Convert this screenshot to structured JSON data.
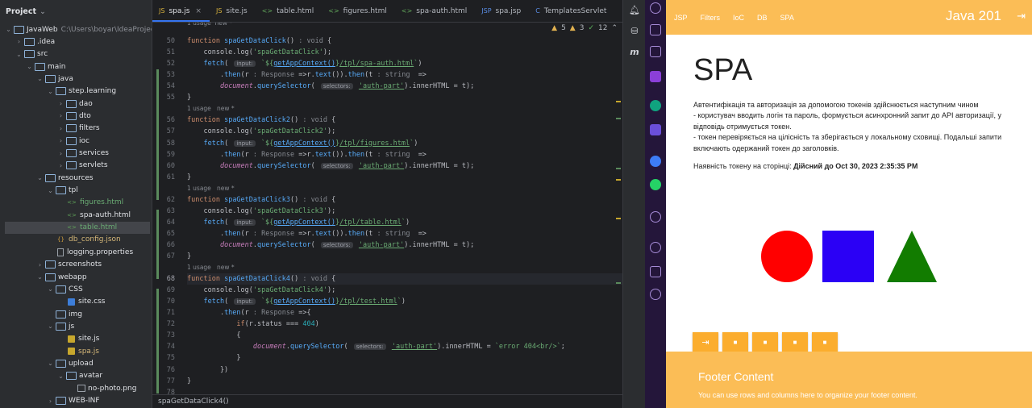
{
  "project": {
    "title": "Project",
    "rows": [
      {
        "label": "JavaWeb",
        "path": "C:\\Users\\boyar\\IdeaProject\\",
        "icon": "folder",
        "arrow": "v",
        "d": 0
      },
      {
        "label": ".idea",
        "icon": "folder",
        "arrow": ">",
        "d": 1
      },
      {
        "label": "src",
        "icon": "folder",
        "arrow": "v",
        "d": 1
      },
      {
        "label": "main",
        "icon": "folder",
        "arrow": "v",
        "d": 2
      },
      {
        "label": "java",
        "icon": "folder",
        "arrow": "v",
        "d": 3
      },
      {
        "label": "step.learning",
        "icon": "folder",
        "arrow": "v",
        "d": 4
      },
      {
        "label": "dao",
        "icon": "folder",
        "arrow": ">",
        "d": 5
      },
      {
        "label": "dto",
        "icon": "folder",
        "arrow": ">",
        "d": 5
      },
      {
        "label": "filters",
        "icon": "folder",
        "arrow": ">",
        "d": 5
      },
      {
        "label": "ioc",
        "icon": "folder",
        "arrow": ">",
        "d": 5
      },
      {
        "label": "services",
        "icon": "folder",
        "arrow": ">",
        "d": 5
      },
      {
        "label": "servlets",
        "icon": "folder",
        "arrow": ">",
        "d": 5
      },
      {
        "label": "resources",
        "icon": "folder",
        "arrow": "v",
        "d": 3
      },
      {
        "label": "tpl",
        "icon": "folder",
        "arrow": "v",
        "d": 4
      },
      {
        "label": "figures.html",
        "icon": "html",
        "arrow": "",
        "d": 5,
        "c": "g"
      },
      {
        "label": "spa-auth.html",
        "icon": "html",
        "arrow": "",
        "d": 5
      },
      {
        "label": "table.html",
        "icon": "html",
        "arrow": "",
        "d": 5,
        "c": "g",
        "sel": true
      },
      {
        "label": "db_config.json",
        "icon": "json",
        "arrow": "",
        "d": 4,
        "c": "y"
      },
      {
        "label": "logging.properties",
        "icon": "file",
        "arrow": "",
        "d": 4
      },
      {
        "label": "screenshots",
        "icon": "folder",
        "arrow": ">",
        "d": 3
      },
      {
        "label": "webapp",
        "icon": "folder",
        "arrow": "v",
        "d": 3
      },
      {
        "label": "CSS",
        "icon": "folder",
        "arrow": "v",
        "d": 4
      },
      {
        "label": "site.css",
        "icon": "css",
        "arrow": "",
        "d": 5
      },
      {
        "label": "img",
        "icon": "folder",
        "arrow": "",
        "d": 4
      },
      {
        "label": "js",
        "icon": "folder",
        "arrow": "v",
        "d": 4
      },
      {
        "label": "site.js",
        "icon": "js",
        "arrow": "",
        "d": 5
      },
      {
        "label": "spa.js",
        "icon": "js",
        "arrow": "",
        "d": 5,
        "c": "y"
      },
      {
        "label": "upload",
        "icon": "folder",
        "arrow": "v",
        "d": 4
      },
      {
        "label": "avatar",
        "icon": "folder",
        "arrow": "v",
        "d": 5
      },
      {
        "label": "no-photo.png",
        "icon": "img",
        "arrow": "",
        "d": 6
      },
      {
        "label": "WEB-INF",
        "icon": "folder",
        "arrow": ">",
        "d": 4
      }
    ]
  },
  "tabs": [
    {
      "label": "spa.js",
      "icon": "JS",
      "active": true
    },
    {
      "label": "site.js",
      "icon": "JS"
    },
    {
      "label": "table.html",
      "icon": "<>"
    },
    {
      "label": "figures.html",
      "icon": "<>"
    },
    {
      "label": "spa-auth.html",
      "icon": "<>"
    },
    {
      "label": "spa.jsp",
      "icon": "JSP"
    },
    {
      "label": "TemplatesServlet",
      "icon": "C"
    }
  ],
  "inspections": {
    "warnings": "5",
    "weak": "3",
    "checks": "12"
  },
  "lines": {
    "first": 50,
    "last": 78,
    "current": 68
  },
  "hints": {
    "usage": "1 usage",
    "new": "new *",
    "topFragment": "1 usage  new *"
  },
  "code": {
    "f1": "spaGetDataClick",
    "f2": "spaGetDataClick2",
    "f3": "spaGetDataClick3",
    "f4": "spaGetDataClick4",
    "l1": "'spaGetDataClick'",
    "l2": "'spaGetDataClick2'",
    "l3": "'spaGetDataClick3'",
    "l4": "'spaGetDataClick4'",
    "u1": "/tpl/spa-auth.html",
    "u2": "/tpl/figures.html",
    "u3": "/tpl/table.html",
    "u4": "/tpl/test.html",
    "ctx": "getAppContext()",
    "sel": "'auth-part'",
    "err": "`error 404<br/>`"
  },
  "breadcrumb": "spaGetDataClick4()",
  "browser": {
    "nav": [
      "JSP",
      "Filters",
      "IoC",
      "DB",
      "SPA"
    ],
    "brand": "Java 201",
    "heading": "SPA",
    "description": [
      "Автентифікація та авторизація за допомогою токенів здійснюється наступним чином",
      "- користувач вводить логін та пароль, формується асинхронний запит до API авторизації, у відповідь отримується токен.",
      "- токен перевіряється на цілісність та зберігається у локальному сховищі. Подальші запити включають одержаний токен до заголовків."
    ],
    "tokenLabel": "Наявність токену на сторінці:",
    "tokenValue": "Дійсний до Oct 30, 2023 2:35:35 PM",
    "shapeColors": {
      "circle": "#ff0000",
      "square": "#2b00f5",
      "triangle": "#127c00"
    },
    "buttons": [
      "logout-icon",
      "folder-icon",
      "folder-icon",
      "folder-icon",
      "folder-icon"
    ],
    "footerTitle": "Footer Content",
    "footerText": "You can use rows and columns here to organize your footer content."
  },
  "colors": {
    "navBg": "#fbbd56",
    "button": "#fbad2e",
    "ideBg": "#1e1f22",
    "panel": "#2b2d30",
    "accent": "#3574f0"
  }
}
